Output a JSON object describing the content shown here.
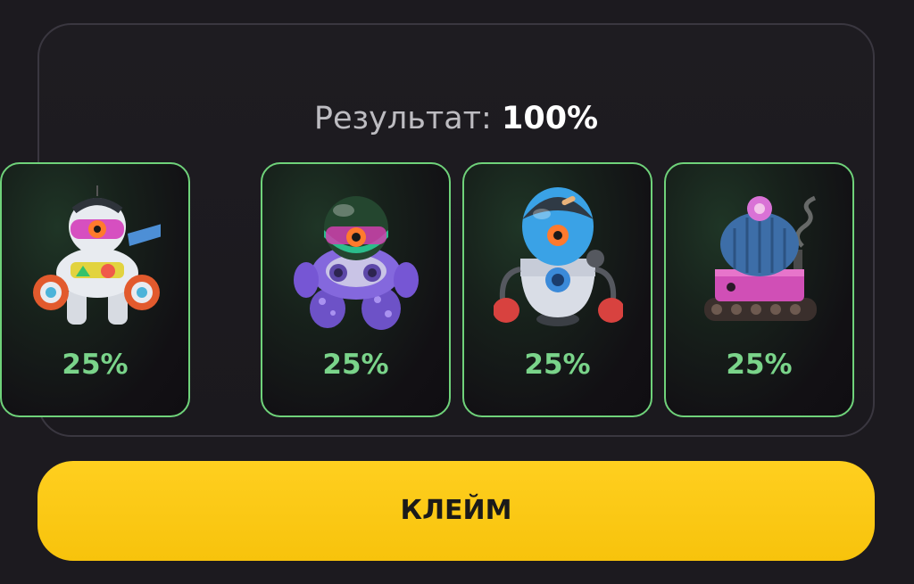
{
  "result": {
    "label": "Результат:",
    "value": "100%"
  },
  "cards": [
    {
      "name": "purple-mech-robot",
      "percent": "25%"
    },
    {
      "name": "blue-boxing-robot",
      "percent": "25%"
    },
    {
      "name": "cactus-tank-robot",
      "percent": "25%"
    },
    {
      "name": "white-mech-robot",
      "percent": "25%"
    }
  ],
  "claim_button": {
    "label": "КЛЕЙМ"
  },
  "colors": {
    "background": "#1c1a1f",
    "card_border": "#6fd27a",
    "percent_text": "#7ad48a",
    "button": "#f9c60f"
  }
}
